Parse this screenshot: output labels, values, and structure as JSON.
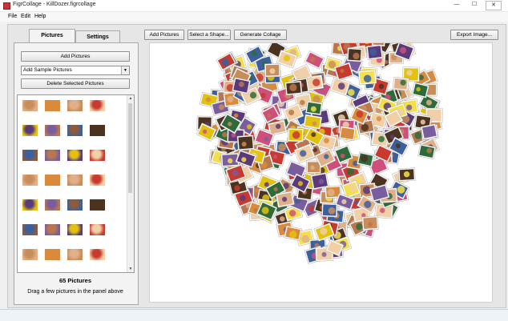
{
  "window": {
    "title": "FigrCollage - KillDozer.figrcollage",
    "minimize_glyph": "—",
    "maximize_glyph": "☐",
    "close_glyph": "✕"
  },
  "menu": [
    "File",
    "Edit",
    "Help"
  ],
  "tabs": {
    "pictures": "Pictures",
    "settings": "Settings"
  },
  "left_panel": {
    "add_pictures_label": "Add Pictures",
    "sample_select_value": "Add Sample Pictures",
    "delete_label": "Delete Selected Pictures",
    "picture_count": "65 Pictures",
    "hint": "Drag a few pictures in the panel above"
  },
  "toolbar": {
    "add_pictures_label": "Add Pictures",
    "select_shape_label": "Select a Shape...",
    "generate_label": "Generate Collage",
    "export_label": "Export Image..."
  },
  "thumb_palette": [
    "#b8774f",
    "#e0b08a",
    "#4b3320",
    "#c98d5a",
    "#7a5d9e",
    "#e3c20f",
    "#c83a2e",
    "#3c5f9e",
    "#d98a3b",
    "#8c5a3c",
    "#f1d0a8",
    "#5a3a7a"
  ],
  "collage_palette": [
    "#b8774f",
    "#e0b08a",
    "#4b3320",
    "#c98d5a",
    "#7a5d9e",
    "#e3c20f",
    "#c83a2e",
    "#3c5f9e",
    "#d98a3b",
    "#2f6b3a",
    "#f1d0a8",
    "#5a3a7a",
    "#d04f7a",
    "#f4e04d"
  ]
}
